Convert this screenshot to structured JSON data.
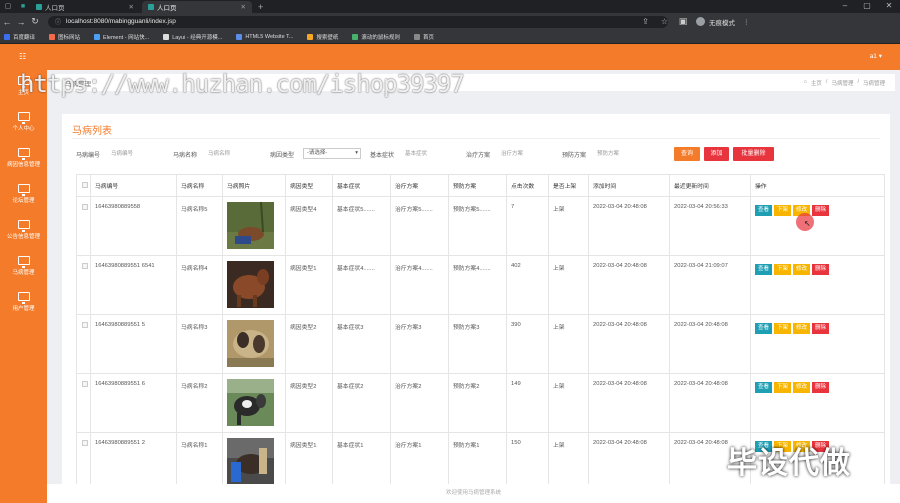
{
  "browser": {
    "tabs": [
      {
        "label": "人口页",
        "active": false
      },
      {
        "label": "人口页",
        "active": true
      }
    ],
    "url": "localhost:8080/mabingguanli/index.jsp",
    "incognito_label": "无痕模式",
    "bookmarks": [
      {
        "label": "百度翻译",
        "color": "#3b6ff0"
      },
      {
        "label": "图标网站",
        "color": "#f56b4a"
      },
      {
        "label": "Element - 网站快...",
        "color": "#4aa0f5"
      },
      {
        "label": "Layui - 经典开源模...",
        "color": "#ddd"
      },
      {
        "label": "HTML5 Website T...",
        "color": "#5a8ee8"
      },
      {
        "label": "搜索壁纸",
        "color": "#f5a623"
      },
      {
        "label": "滚动的鼠标规则",
        "color": "#47b26b"
      },
      {
        "label": "首页",
        "color": "#888"
      }
    ]
  },
  "app": {
    "user_label": "a1 ▾",
    "watermark": "https://www.huzhan.com/ishop39397",
    "overlay_text": "毕设代做",
    "sidebar": {
      "items": [
        {
          "label": "主页"
        },
        {
          "label": "个人中心"
        },
        {
          "label": "病因信息管理"
        },
        {
          "label": "论坛管理"
        },
        {
          "label": "公告信息管理"
        },
        {
          "label": "马病管理"
        },
        {
          "label": "用户管理"
        }
      ]
    },
    "breadcrumb": {
      "title": "马病管理",
      "home": "主页",
      "path1": "马病管理",
      "path2": "马病管理"
    },
    "card_title": "马病列表",
    "search": {
      "fields": [
        {
          "label": "马病编号",
          "placeholder": "马病编号"
        },
        {
          "label": "马病名称",
          "placeholder": "马病名称"
        },
        {
          "label": "病因类型",
          "placeholder": "-请选择-"
        },
        {
          "label": "基本症状",
          "placeholder": "基本症状"
        },
        {
          "label": "治疗方案",
          "placeholder": "治疗方案"
        },
        {
          "label": "预防方案",
          "placeholder": "预防方案"
        }
      ],
      "btn_query": "查询",
      "btn_add": "添加",
      "btn_batch_delete": "批量删除"
    },
    "table": {
      "headers": [
        "马病编号",
        "马病名称",
        "马病照片",
        "病因类型",
        "基本症状",
        "治疗方案",
        "预防方案",
        "点击次数",
        "是否上架",
        "添加时间",
        "最近更新时间",
        "操作"
      ],
      "rows": [
        {
          "id": "16463980889558",
          "name": "马病名称5",
          "type": "病因类型4",
          "symptom": "基本症状5.......",
          "treat": "治疗方案5.......",
          "prevent": "预防方案5.......",
          "clicks": "7",
          "status": "上架",
          "added": "2022-03-04 20:48:08",
          "updated": "2022-03-04 20:56:33",
          "photo": "photo-horse-5"
        },
        {
          "id": "16463980889551 6541",
          "name": "马病名称4",
          "type": "病因类型1",
          "symptom": "基本症状4.......",
          "treat": "治疗方案4.......",
          "prevent": "预防方案4.......",
          "clicks": "402",
          "status": "上架",
          "added": "2022-03-04 20:48:08",
          "updated": "2022-03-04 21:09:07",
          "photo": "photo-horse-4"
        },
        {
          "id": "16463980889551 5",
          "name": "马病名称3",
          "type": "病因类型2",
          "symptom": "基本症状3",
          "treat": "治疗方案3",
          "prevent": "预防方案3",
          "clicks": "390",
          "status": "上架",
          "added": "2022-03-04 20:48:08",
          "updated": "2022-03-04 20:48:08",
          "photo": "photo-horse-3"
        },
        {
          "id": "16463980889551 6",
          "name": "马病名称2",
          "type": "病因类型2",
          "symptom": "基本症状2",
          "treat": "治疗方案2",
          "prevent": "预防方案2",
          "clicks": "149",
          "status": "上架",
          "added": "2022-03-04 20:48:08",
          "updated": "2022-03-04 20:48:08",
          "photo": "photo-horse-2"
        },
        {
          "id": "16463980889551 2",
          "name": "马病名称1",
          "type": "病因类型1",
          "symptom": "基本症状1",
          "treat": "治疗方案1",
          "prevent": "预防方案1",
          "clicks": "150",
          "status": "上架",
          "added": "2022-03-04 20:48:08",
          "updated": "2022-03-04 20:48:08",
          "photo": "photo-horse-1"
        }
      ],
      "ops": {
        "view": "查看",
        "down": "下架",
        "edit": "修改",
        "delete": "删除"
      }
    },
    "footer": "欢迎使用马病管理系统"
  }
}
